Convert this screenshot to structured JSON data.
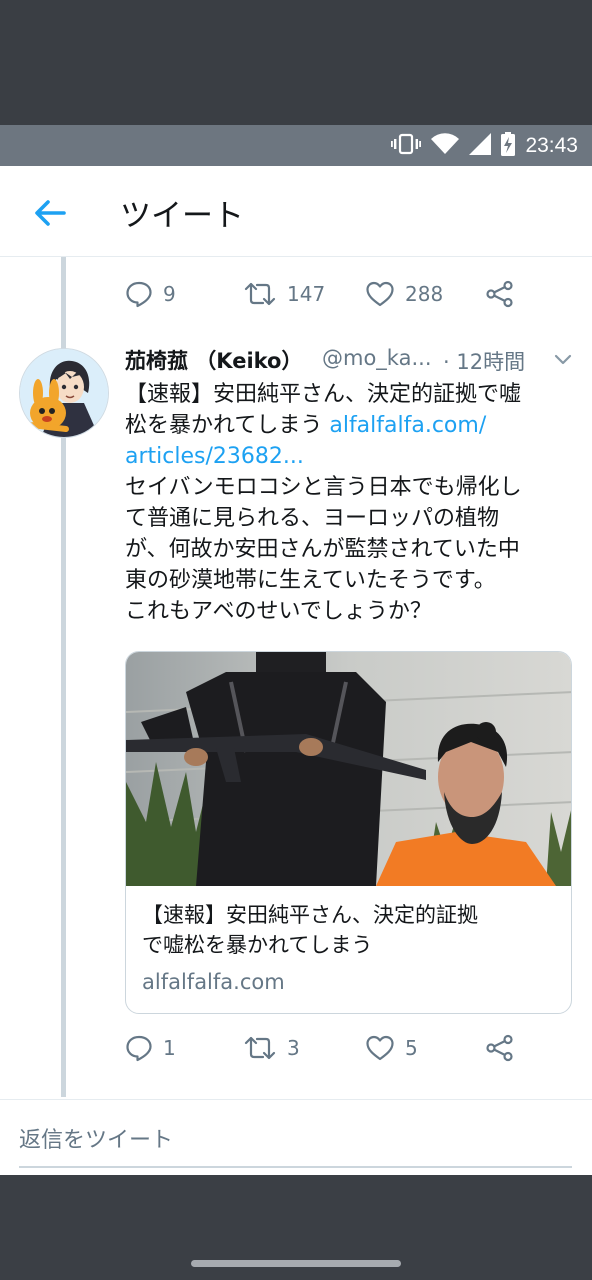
{
  "status_bar": {
    "time": "23:43",
    "icons": [
      "vibrate-icon",
      "wifi-icon",
      "signal-icon",
      "battery-charging-icon"
    ]
  },
  "app_bar": {
    "back_icon": "arrow-left-icon",
    "title": "ツイート",
    "accent_color": "#1da1f2"
  },
  "previous_tweet": {
    "reply_count": "9",
    "retweet_count": "147",
    "like_count": "288"
  },
  "tweet": {
    "display_name": "茄椅菰 （Keiko）",
    "handle": "@mo_ka...",
    "time": "· 12時間",
    "body_lines": [
      "【速報】安田純平さん、決定的証拠で嘘",
      "松を暴かれてしまう "
    ],
    "link_part1": "alfalfalfa.com/",
    "link_part2": "articles/23682...",
    "body_lines_after": [
      "セイバンモロコシと言う日本でも帰化し",
      "て普通に見られる、ヨーロッパの植物",
      "が、何故か安田さんが監禁されていた中",
      "東の砂漠地帯に生えていたそうです。",
      "これもアベのせいでしょうか？"
    ],
    "card": {
      "title_line1": "【速報】安田純平さん、決定的証拠",
      "title_line2": "で嘘松を暴かれてしまう",
      "domain": "alfalfalfa.com"
    },
    "reply_count": "1",
    "retweet_count": "3",
    "like_count": "5"
  },
  "reply_box": {
    "placeholder": "返信をツイート"
  }
}
